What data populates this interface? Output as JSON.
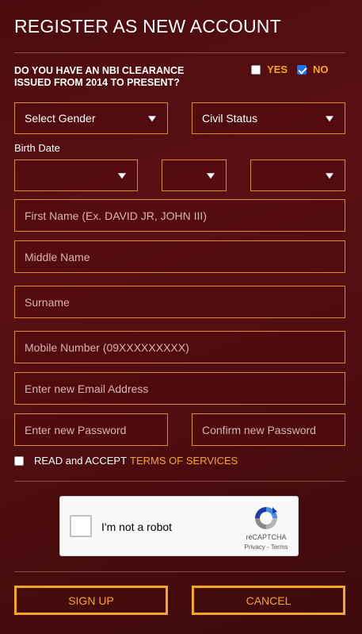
{
  "header": {
    "title": "REGISTER AS NEW ACCOUNT"
  },
  "nbi": {
    "question": "DO YOU HAVE AN NBI CLEARANCE ISSUED FROM 2014 TO PRESENT?",
    "yes_label": "YES",
    "no_label": "NO",
    "yes_checked": false,
    "no_checked": true
  },
  "selects": {
    "gender": "Select Gender",
    "civil_status": "Civil Status",
    "birth_label": "Birth Date",
    "birth_month": "",
    "birth_day": "",
    "birth_year": ""
  },
  "fields": {
    "first_name": "First Name (Ex. DAVID JR, JOHN III)",
    "middle_name": "Middle Name",
    "surname": "Surname",
    "mobile": "Mobile Number (09XXXXXXXXX)",
    "email": "Enter new Email Address",
    "password": "Enter new Password",
    "confirm_password": "Confirm new Password"
  },
  "terms": {
    "prefix": "READ and ACCEPT",
    "link": "TERMS OF SERVICES",
    "checked": false
  },
  "captcha": {
    "label": "I'm not a robot",
    "brand": "reCAPTCHA",
    "links": "Privacy - Terms"
  },
  "actions": {
    "signup": "SIGN UP",
    "cancel": "CANCEL"
  },
  "colors": {
    "accent": "#f5a623",
    "background": "#4a0c0e",
    "field_border": "#d98c2a"
  }
}
